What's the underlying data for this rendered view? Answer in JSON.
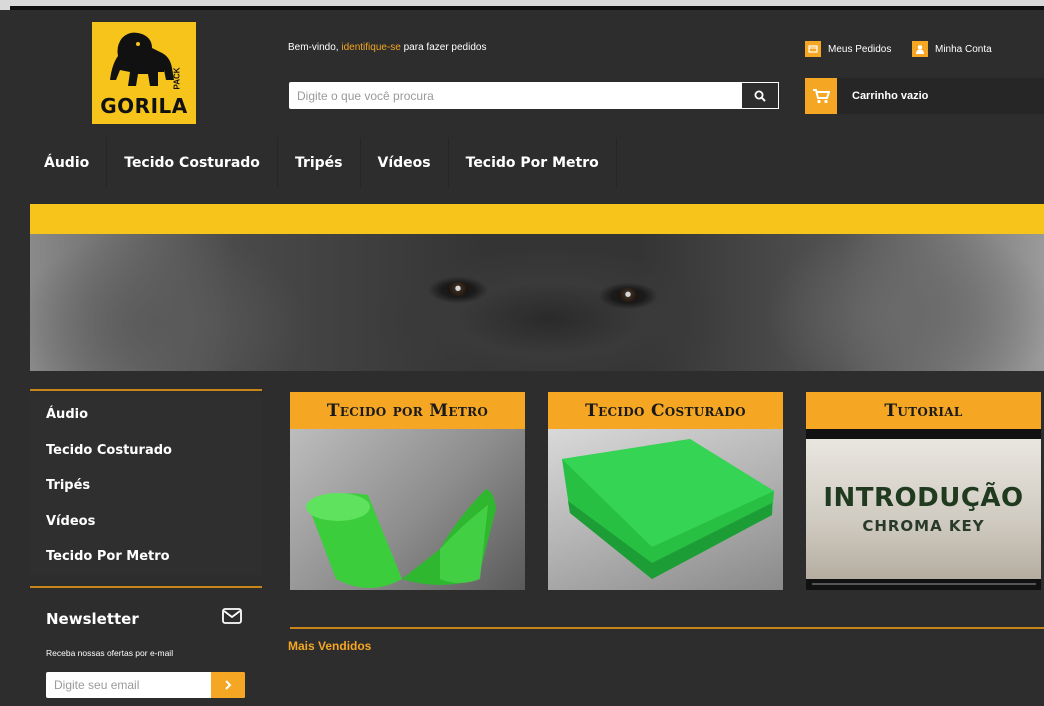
{
  "brand": {
    "logo_text": "GORILA",
    "logo_small": "PACK",
    "accent": "#f5a623",
    "logo_yellow": "#f7c41c"
  },
  "header": {
    "welcome_prefix": "Bem-vindo,",
    "welcome_link": "identifique-se",
    "welcome_suffix": "para fazer pedidos",
    "search_placeholder": "Digite o que você procura",
    "orders_label": "Meus Pedidos",
    "account_label": "Minha Conta",
    "cart_label": "Carrinho vazio"
  },
  "nav": {
    "items": [
      "Áudio",
      "Tecido Costurado",
      "Tripés",
      "Vídeos",
      "Tecido Por Metro"
    ]
  },
  "sidebar": {
    "categories": [
      "Áudio",
      "Tecido Costurado",
      "Tripés",
      "Vídeos",
      "Tecido Por Metro"
    ]
  },
  "newsletter": {
    "title": "Newsletter",
    "text": "Receba nossas ofertas por e-mail",
    "placeholder": "Digite seu email"
  },
  "cards": [
    {
      "title": "Tecido por Metro"
    },
    {
      "title": "Tecido Costurado"
    },
    {
      "title": "Tutorial",
      "video_title": "INTRODUÇÃO",
      "video_subtitle": "CHROMA KEY"
    }
  ],
  "best_sellers": {
    "title": "Mais Vendidos"
  }
}
